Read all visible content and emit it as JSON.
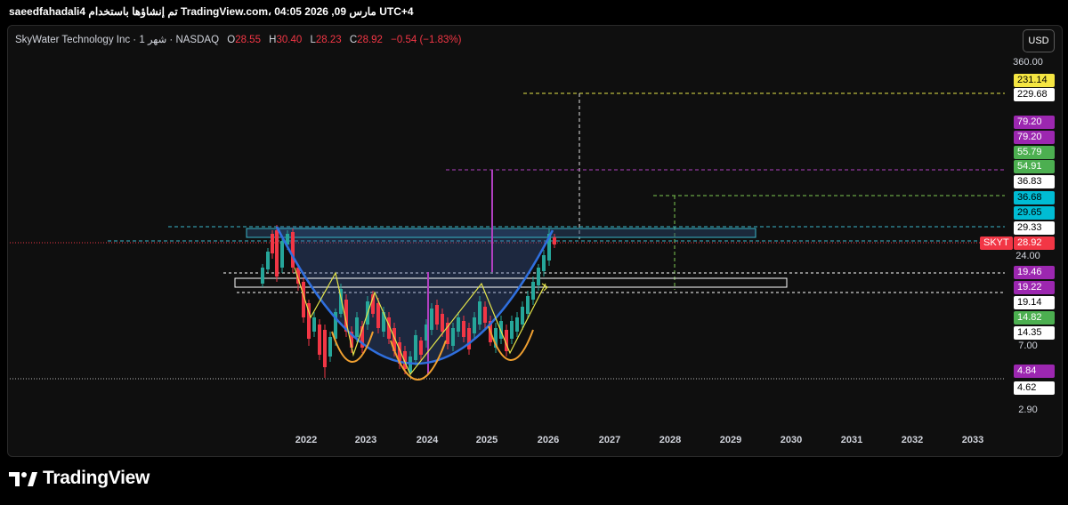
{
  "topbar": {
    "text": "saeedfahadali4 تم إنشاؤها باستخدام TradingView.com، 04:05 2026 ,09 مارس UTC+4"
  },
  "legend": {
    "symbol": "SkyWater Technology Inc · 1 شهر · NASDAQ",
    "o_label": "O",
    "o_value": "28.55",
    "h_label": "H",
    "h_value": "30.40",
    "l_label": "L",
    "l_value": "28.23",
    "c_label": "C",
    "c_value": "28.92",
    "change": "−0.54 (−1.83%)"
  },
  "currency_button": "USD",
  "price_axis": {
    "ticks": [
      "360.00",
      "24.00",
      "7.00",
      "2.90"
    ],
    "labels": [
      {
        "text": "231.14",
        "bg": "#f5e642",
        "fg": "#000000"
      },
      {
        "text": "229.68",
        "bg": "#ffffff",
        "fg": "#000000"
      },
      {
        "text": "79.20",
        "bg": "#9c27b0",
        "fg": "#ffffff"
      },
      {
        "text": "79.20",
        "bg": "#9c27b0",
        "fg": "#ffffff"
      },
      {
        "text": "55.79",
        "bg": "#4caf50",
        "fg": "#ffffff"
      },
      {
        "text": "54.91",
        "bg": "#4caf50",
        "fg": "#ffffff"
      },
      {
        "text": "36.83",
        "bg": "#ffffff",
        "fg": "#000000"
      },
      {
        "text": "36.68",
        "bg": "#00bcd4",
        "fg": "#000000"
      },
      {
        "text": "29.65",
        "bg": "#00bcd4",
        "fg": "#000000"
      },
      {
        "text": "29.33",
        "bg": "#ffffff",
        "fg": "#000000"
      },
      {
        "text": "28.92",
        "bg": "#f23645",
        "fg": "#ffffff"
      },
      {
        "text": "19.46",
        "bg": "#9c27b0",
        "fg": "#ffffff"
      },
      {
        "text": "19.22",
        "bg": "#9c27b0",
        "fg": "#ffffff"
      },
      {
        "text": "19.14",
        "bg": "#ffffff",
        "fg": "#000000"
      },
      {
        "text": "14.82",
        "bg": "#4caf50",
        "fg": "#ffffff"
      },
      {
        "text": "14.35",
        "bg": "#ffffff",
        "fg": "#000000"
      },
      {
        "text": "4.84",
        "bg": "#9c27b0",
        "fg": "#ffffff"
      },
      {
        "text": "4.62",
        "bg": "#ffffff",
        "fg": "#000000"
      }
    ],
    "ticker_tag": {
      "text": "SKYT",
      "bg": "#f23645",
      "fg": "#ffffff"
    }
  },
  "time_axis": {
    "ticks": [
      "2022",
      "2023",
      "2024",
      "2025",
      "2026",
      "2027",
      "2028",
      "2029",
      "2030",
      "2031",
      "2032",
      "2033"
    ]
  },
  "colors": {
    "up": "#26a69a",
    "down": "#f23645",
    "bowl": "#2f6fde",
    "cup": "#f0a030",
    "zigzag": "#e6e64a"
  },
  "footer": {
    "brand": "TradingView"
  }
}
